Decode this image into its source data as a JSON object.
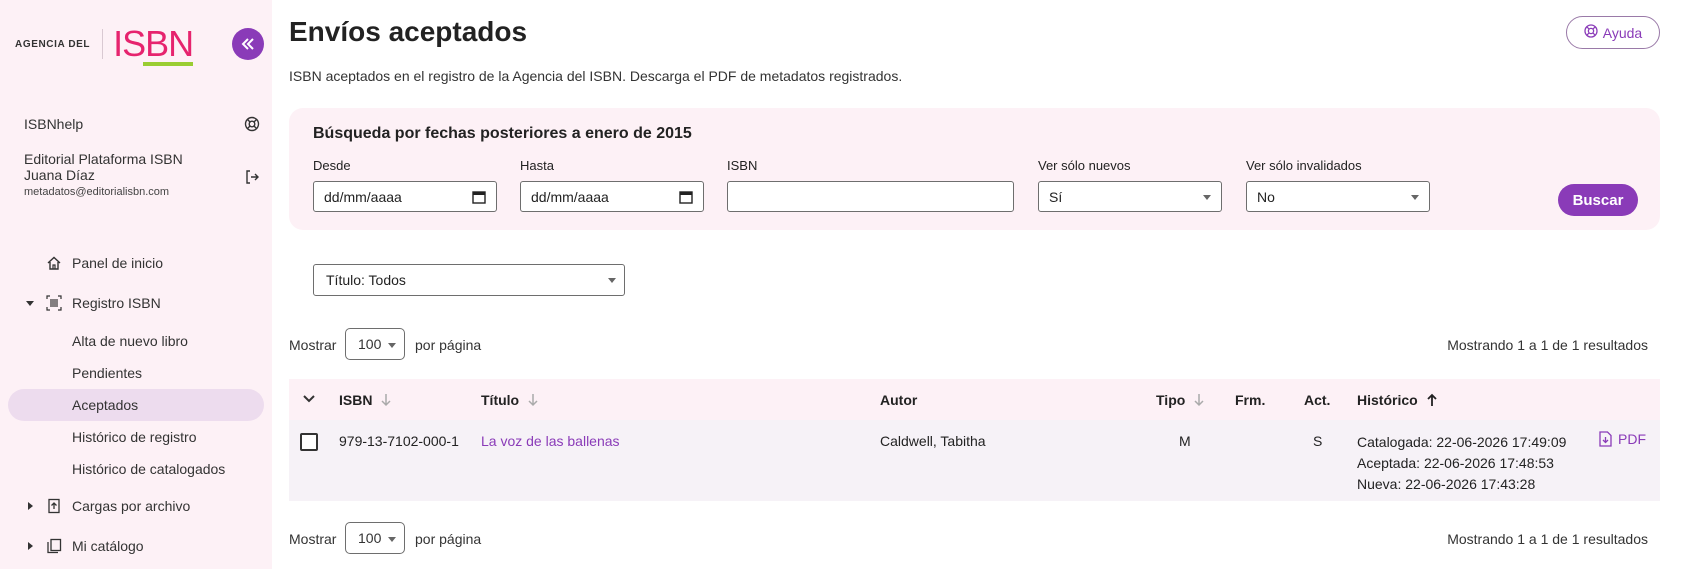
{
  "brand": {
    "agency_label": "AGENCIA DEL",
    "name": "ISBN"
  },
  "sidebar": {
    "help_label": "ISBNhelp",
    "user": {
      "company": "Editorial Plataforma ISBN",
      "name": "Juana Díaz",
      "email": "metadatos@editorialisbn.com"
    },
    "nav": {
      "home": "Panel de inicio",
      "registro": "Registro ISBN",
      "alta": "Alta de nuevo libro",
      "pendientes": "Pendientes",
      "aceptados": "Aceptados",
      "historico_registro": "Histórico de registro",
      "historico_catalogados": "Histórico de catalogados",
      "cargas": "Cargas por archivo",
      "catalogo": "Mi catálogo"
    }
  },
  "header": {
    "title": "Envíos aceptados",
    "help_button": "Ayuda",
    "subtitle": "ISBN aceptados en el registro de la Agencia del ISBN. Descarga el PDF de metadatos registrados."
  },
  "search": {
    "title": "Búsqueda por fechas posteriores a enero de 2015",
    "desde_label": "Desde",
    "desde_value": "dd/mm/aaaa",
    "hasta_label": "Hasta",
    "hasta_value": "dd/mm/aaaa",
    "isbn_label": "ISBN",
    "isbn_value": "",
    "nuevos_label": "Ver sólo nuevos",
    "nuevos_value": "Sí",
    "invalidados_label": "Ver sólo invalidados",
    "invalidados_value": "No",
    "search_button": "Buscar"
  },
  "filter": {
    "titulo": "Título: Todos"
  },
  "pager": {
    "show_label": "Mostrar",
    "per_page_value": "100",
    "per_page_label": "por página",
    "results_text": "Mostrando 1 a 1 de 1 resultados"
  },
  "table": {
    "headers": {
      "isbn": "ISBN",
      "titulo": "Título",
      "autor": "Autor",
      "tipo": "Tipo",
      "frm": "Frm.",
      "act": "Act.",
      "historico": "Histórico"
    },
    "rows": [
      {
        "isbn": "979-13-7102-000-1",
        "titulo": "La voz de las ballenas",
        "autor": "Caldwell, Tabitha",
        "tipo": "M",
        "frm": "",
        "act": "S",
        "historico": [
          "Catalogada: 22-06-2026 17:49:09",
          "Aceptada: 22-06-2026 17:48:53",
          "Nueva: 22-06-2026 17:43:28"
        ],
        "pdf_label": "PDF"
      }
    ]
  },
  "colors": {
    "accent": "#8a3bb8",
    "brand": "#e6246e",
    "panel": "#fdf1f6"
  }
}
